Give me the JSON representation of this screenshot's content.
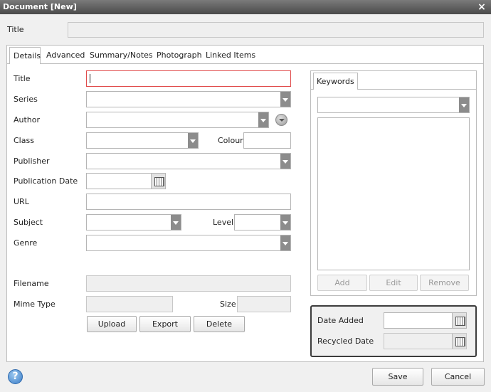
{
  "window": {
    "title": "Document [New]",
    "close_symbol": "×"
  },
  "header": {
    "title_label": "Title",
    "title_value": ""
  },
  "tabs": [
    {
      "label": "Details",
      "active": true
    },
    {
      "label": "Advanced",
      "active": false
    },
    {
      "label": "Summary/Notes",
      "active": false
    },
    {
      "label": "Photograph",
      "active": false
    },
    {
      "label": "Linked Items",
      "active": false
    }
  ],
  "details": {
    "title_label": "Title",
    "series_label": "Series",
    "author_label": "Author",
    "class_label": "Class",
    "colour_label": "Colour",
    "publisher_label": "Publisher",
    "publication_date_label": "Publication Date",
    "url_label": "URL",
    "subject_label": "Subject",
    "level_label": "Level",
    "genre_label": "Genre",
    "filename_label": "Filename",
    "mime_type_label": "Mime Type",
    "size_label": "Size",
    "title_value": "",
    "series_value": "",
    "author_value": "",
    "class_value": "",
    "colour_value": "",
    "publisher_value": "",
    "publication_date_value": "",
    "url_value": "",
    "subject_value": "",
    "level_value": "",
    "genre_value": "",
    "filename_value": "",
    "mime_type_value": "",
    "size_value": ""
  },
  "file_buttons": {
    "upload": "Upload",
    "export": "Export",
    "delete": "Delete"
  },
  "keywords": {
    "tab_label": "Keywords",
    "add": "Add",
    "edit": "Edit",
    "remove": "Remove"
  },
  "dates": {
    "date_added_label": "Date Added",
    "recycled_date_label": "Recycled Date",
    "date_added_value": "",
    "recycled_date_value": ""
  },
  "footer": {
    "help_symbol": "?",
    "save": "Save",
    "cancel": "Cancel"
  },
  "colors": {
    "titlebar": "#5a5a5a",
    "focus_border": "#e04b4b",
    "help_icon": "#4a90d9"
  }
}
